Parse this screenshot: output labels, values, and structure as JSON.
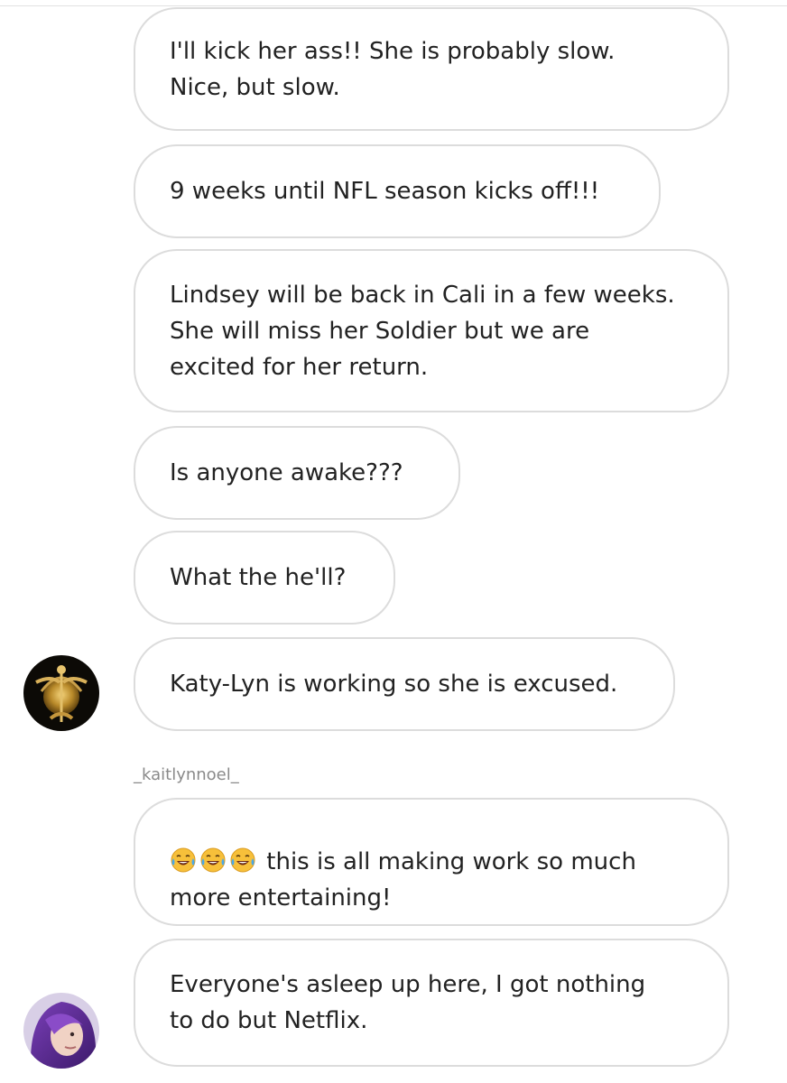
{
  "messages": [
    {
      "text": "I'll kick her ass!! She is probably slow.\nNice, but slow."
    },
    {
      "text": "9 weeks until NFL season kicks off!!!"
    },
    {
      "text": "Lindsey will be back in Cali in a few weeks.\nShe will miss her Soldier but we are\nexcited for her return."
    },
    {
      "text": "Is anyone awake???"
    },
    {
      "text": "What the he'll?"
    },
    {
      "text": "Katy-Lyn is working so she is excused."
    },
    {
      "text": "this is all making work so much\nmore entertaining!",
      "emoji": [
        "face-with-tears-of-joy-icon",
        "face-with-tears-of-joy-icon",
        "face-with-tears-of-joy-icon"
      ]
    },
    {
      "text": "Everyone's asleep up here, I got nothing\nto do but Netflix."
    }
  ],
  "senders": {
    "username_2": "_kaitlynnoel_"
  },
  "avatars": {
    "user_1": "marine-emblem-avatar",
    "user_3": "purple-hair-profile-avatar"
  },
  "colors": {
    "bubble_border": "#dcdcdc",
    "text": "#222222",
    "username": "#8a8a8a",
    "emoji_face": "#f7c03a",
    "emoji_tear": "#4aa8e8"
  }
}
